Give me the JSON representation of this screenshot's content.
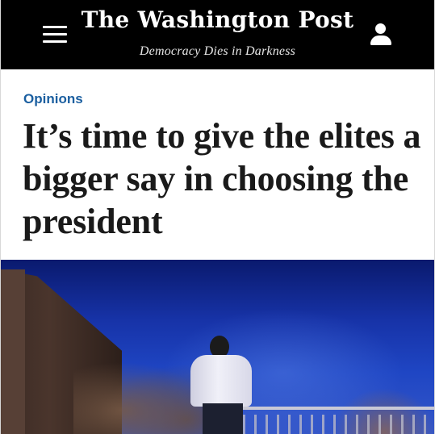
{
  "header": {
    "masthead": "The Washington Post",
    "tagline": "Democracy Dies in Darkness",
    "menu_icon": "hamburger-menu-icon",
    "account_icon": "user-account-icon"
  },
  "article": {
    "section": "Opinions",
    "headline": "It’s time to give the elites a bigger say in choosing the president"
  },
  "colors": {
    "header_bg": "#000000",
    "section_accent": "#1b5fa0",
    "headline_text": "#1a1a1a"
  }
}
